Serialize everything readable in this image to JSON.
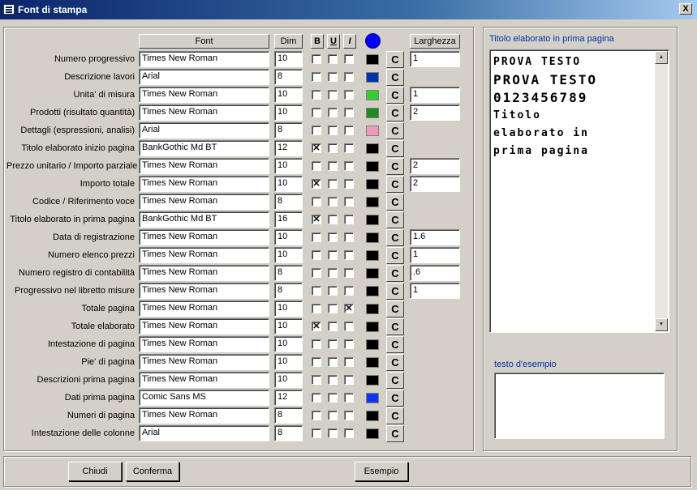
{
  "window": {
    "title": "Font di stampa",
    "close_glyph": "X"
  },
  "headers": {
    "font": "Font",
    "dim": "Dim",
    "bold": "B",
    "underline": "U",
    "italic": "I",
    "color": "blue-circle-icon",
    "width": "Larghezza"
  },
  "rows": [
    {
      "label": "Numero progressivo",
      "font": "Times New Roman",
      "dim": "10",
      "b": "",
      "u": "",
      "i": "",
      "color": "#000000",
      "width": "1"
    },
    {
      "label": "Descrizione lavori",
      "font": "Arial",
      "dim": "8",
      "b": "",
      "u": "",
      "i": "",
      "color": "#0033aa"
    },
    {
      "label": "Unita' di misura",
      "font": "Times New Roman",
      "dim": "10",
      "b": "",
      "u": "",
      "i": "",
      "color": "#33cc33",
      "width": "1"
    },
    {
      "label": "Prodotti (risultato quantità)",
      "font": "Times New Roman",
      "dim": "10",
      "b": "",
      "u": "",
      "i": "",
      "color": "#228822",
      "width": "2"
    },
    {
      "label": "Dettagli (espressioni, analisi)",
      "font": "Arial",
      "dim": "8",
      "b": "",
      "u": "",
      "i": "",
      "color": "#ee99bb"
    },
    {
      "label": "Titolo elaborato inizio pagina",
      "font": "BankGothic Md BT",
      "dim": "12",
      "b": "✕",
      "u": "",
      "i": "",
      "color": "#000000"
    },
    {
      "label": "Prezzo unitario / Importo parziale",
      "font": "Times New Roman",
      "dim": "10",
      "b": "",
      "u": "",
      "i": "",
      "color": "#000000",
      "width": "2"
    },
    {
      "label": "Importo totale",
      "font": "Times New Roman",
      "dim": "10",
      "b": "✕",
      "u": "",
      "i": "",
      "color": "#000000",
      "width": "2"
    },
    {
      "label": "Codice / Riferimento voce",
      "font": "Times New Roman",
      "dim": "8",
      "b": "",
      "u": "",
      "i": "",
      "color": "#000000"
    },
    {
      "label": "Titolo elaborato in prima pagina",
      "font": "BankGothic Md BT",
      "dim": "16",
      "b": "✕",
      "u": "",
      "i": "",
      "color": "#000000"
    },
    {
      "label": "Data di registrazione",
      "font": "Times New Roman",
      "dim": "10",
      "b": "",
      "u": "",
      "i": "",
      "color": "#000000",
      "width": "1.6"
    },
    {
      "label": "Numero elenco prezzi",
      "font": "Times New Roman",
      "dim": "10",
      "b": "",
      "u": "",
      "i": "",
      "color": "#000000",
      "width": "1"
    },
    {
      "label": "Numero registro di contabilità",
      "font": "Times New Roman",
      "dim": "8",
      "b": "",
      "u": "",
      "i": "",
      "color": "#000000",
      "width": ".6"
    },
    {
      "label": "Progressivo nel libretto misure",
      "font": "Times New Roman",
      "dim": "8",
      "b": "",
      "u": "",
      "i": "",
      "color": "#000000",
      "width": "1"
    },
    {
      "label": "Totale pagina",
      "font": "Times New Roman",
      "dim": "10",
      "b": "",
      "u": "",
      "i": "✕",
      "color": "#000000"
    },
    {
      "label": "Totale elaborato",
      "font": "Times New Roman",
      "dim": "10",
      "b": "✕",
      "u": "",
      "i": "",
      "color": "#000000"
    },
    {
      "label": "Intestazione di pagina",
      "font": "Times New Roman",
      "dim": "10",
      "b": "",
      "u": "",
      "i": "",
      "color": "#000000"
    },
    {
      "label": "Pie' di pagina",
      "font": "Times New Roman",
      "dim": "10",
      "b": "",
      "u": "",
      "i": "",
      "color": "#000000"
    },
    {
      "label": "Descrizioni prima pagina",
      "font": "Times New Roman",
      "dim": "10",
      "b": "",
      "u": "",
      "i": "",
      "color": "#000000"
    },
    {
      "label": "Dati prima pagina",
      "font": "Comic Sans MS",
      "dim": "12",
      "b": "",
      "u": "",
      "i": "",
      "color": "#1133ee"
    },
    {
      "label": "Numeri di pagina",
      "font": "Times New Roman",
      "dim": "8",
      "b": "",
      "u": "",
      "i": "",
      "color": "#000000"
    },
    {
      "label": "Intestazione delle colonne",
      "font": "Arial",
      "dim": "8",
      "b": "",
      "u": "",
      "i": "",
      "color": "#000000"
    }
  ],
  "color_button_label": "C",
  "preview": {
    "title": "Titolo elaborato in prima pagina",
    "lines": [
      "PROVA TESTO",
      "PROVA TESTO",
      "0123456789",
      "Titolo",
      "elaborato in",
      "prima pagina"
    ]
  },
  "sample": {
    "label": "testo d'esempio",
    "text": ""
  },
  "buttons": {
    "close": "Chiudi",
    "confirm": "Conferma",
    "example": "Esempio"
  }
}
